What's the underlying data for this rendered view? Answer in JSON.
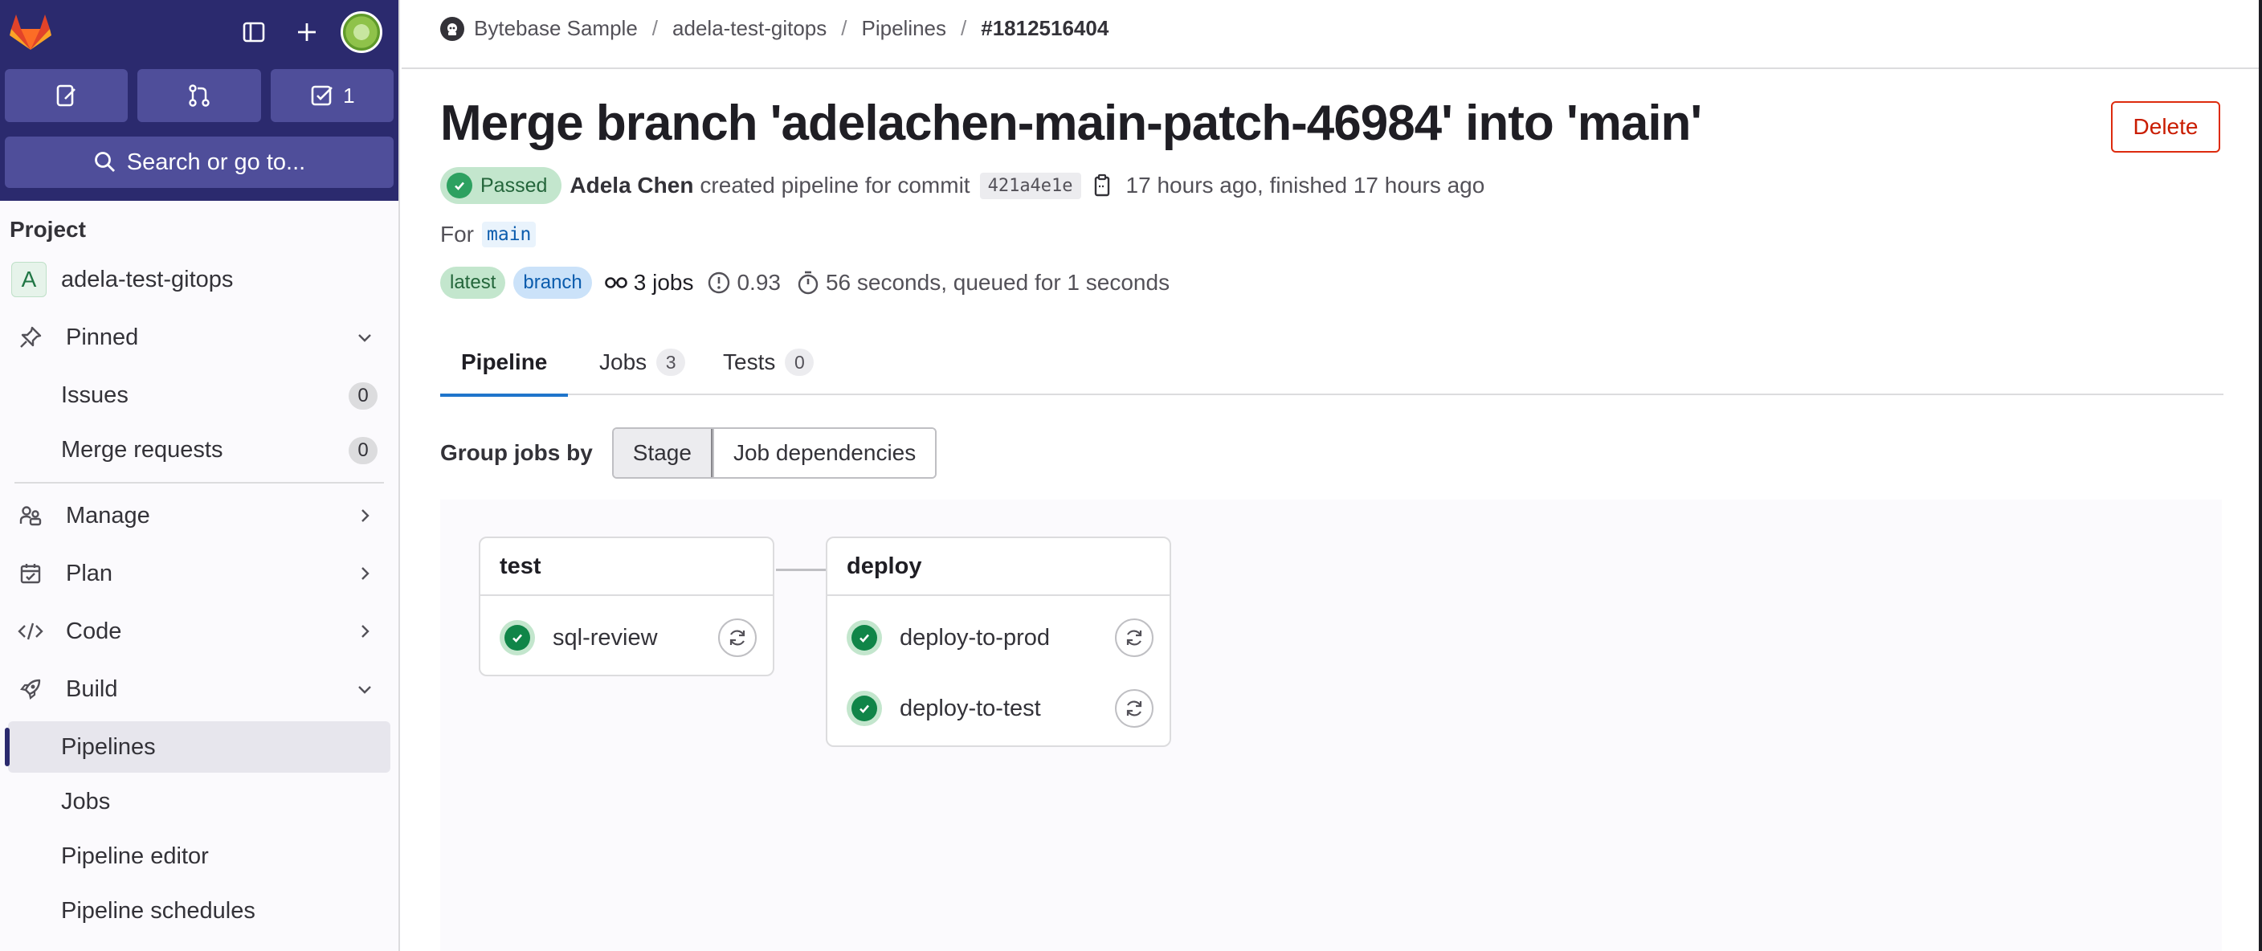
{
  "sidebar": {
    "todo_count": "1",
    "search_label": "Search or go to...",
    "section_title": "Project",
    "project_letter": "A",
    "project_name": "adela-test-gitops",
    "items": [
      {
        "label": "Pinned"
      },
      {
        "label": "Issues",
        "count": "0"
      },
      {
        "label": "Merge requests",
        "count": "0"
      },
      {
        "label": "Manage"
      },
      {
        "label": "Plan"
      },
      {
        "label": "Code"
      },
      {
        "label": "Build"
      },
      {
        "label": "Pipelines"
      },
      {
        "label": "Jobs"
      },
      {
        "label": "Pipeline editor"
      },
      {
        "label": "Pipeline schedules"
      }
    ]
  },
  "breadcrumb": [
    "Bytebase Sample",
    "adela-test-gitops",
    "Pipelines",
    "#1812516404"
  ],
  "header": {
    "title": "Merge branch 'adelachen-main-patch-46984' into 'main'",
    "delete_label": "Delete",
    "status": "Passed",
    "author": "Adela Chen",
    "created_text": "created pipeline for commit",
    "sha": "421a4e1e",
    "time_text": "17 hours ago, finished 17 hours ago",
    "for_label": "For",
    "ref": "main",
    "tag_latest": "latest",
    "tag_branch": "branch",
    "jobs_count": "3 jobs",
    "coverage": "0.93",
    "duration": "56 seconds, queued for 1 seconds"
  },
  "tabs": [
    {
      "label": "Pipeline"
    },
    {
      "label": "Jobs",
      "count": "3"
    },
    {
      "label": "Tests",
      "count": "0"
    }
  ],
  "group": {
    "label": "Group jobs by",
    "options": [
      "Stage",
      "Job dependencies"
    ]
  },
  "stages": [
    {
      "name": "test",
      "jobs": [
        "sql-review"
      ]
    },
    {
      "name": "deploy",
      "jobs": [
        "deploy-to-prod",
        "deploy-to-test"
      ]
    }
  ],
  "colors": {
    "sidebar_top": "#2b2a6e",
    "success": "#108548",
    "danger": "#dd2b0e",
    "link": "#1f75cb"
  }
}
